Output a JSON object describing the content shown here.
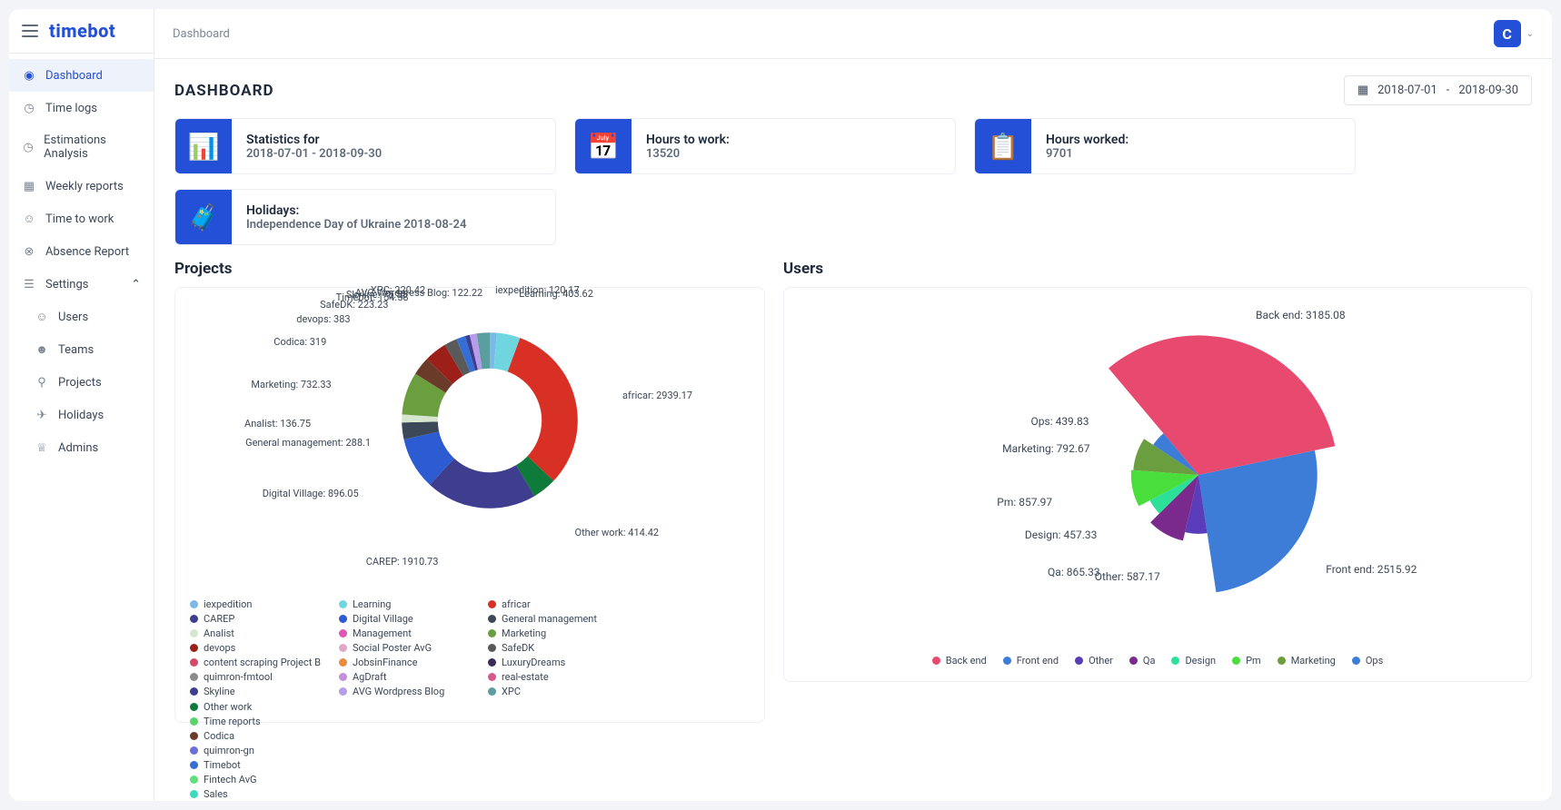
{
  "app_name": "timebot",
  "breadcrumb": "Dashboard",
  "avatar_letter": "C",
  "page_title": "DASHBOARD",
  "date_range": {
    "from": "2018-07-01",
    "to": "2018-09-30"
  },
  "sidebar": {
    "items": [
      {
        "label": "Dashboard"
      },
      {
        "label": "Time logs"
      },
      {
        "label": "Estimations Analysis"
      },
      {
        "label": "Weekly reports"
      },
      {
        "label": "Time to work"
      },
      {
        "label": "Absence Report"
      },
      {
        "label": "Settings"
      }
    ],
    "settings_children": [
      {
        "label": "Users"
      },
      {
        "label": "Teams"
      },
      {
        "label": "Projects"
      },
      {
        "label": "Holidays"
      },
      {
        "label": "Admins"
      }
    ]
  },
  "stats": [
    {
      "label": "Statistics for",
      "value": "2018-07-01 - 2018-09-30"
    },
    {
      "label": "Hours to work:",
      "value": "13520"
    },
    {
      "label": "Hours worked:",
      "value": "9701"
    },
    {
      "label": "Holidays:",
      "value": "Independence Day of Ukraine 2018-08-24"
    }
  ],
  "sections": {
    "projects": "Projects",
    "users": "Users"
  },
  "chart_data": [
    {
      "type": "pie",
      "title": "Projects",
      "donut": true,
      "series": [
        {
          "name": "iexpedition",
          "value": 120.17,
          "color": "#7bb9e8"
        },
        {
          "name": "Learning",
          "value": 403.62,
          "color": "#6fd6e0"
        },
        {
          "name": "africar",
          "value": 2939.17,
          "color": "#d93025"
        },
        {
          "name": "Other work",
          "value": 414.42,
          "color": "#0f7b3a"
        },
        {
          "name": "CAREP",
          "value": 1910.73,
          "color": "#3f3d8e"
        },
        {
          "name": "Digital Village",
          "value": 896.05,
          "color": "#2d5bd1"
        },
        {
          "name": "General management",
          "value": 288.1,
          "color": "#3c4858"
        },
        {
          "name": "Time reports",
          "value": null,
          "color": "#5ad46a"
        },
        {
          "name": "Analist",
          "value": 136.75,
          "color": "#d7e7cf"
        },
        {
          "name": "Management",
          "value": null,
          "color": "#e255b1"
        },
        {
          "name": "Marketing",
          "value": 732.33,
          "color": "#6b9e3f"
        },
        {
          "name": "Codica",
          "value": 319,
          "color": "#6b3b2a"
        },
        {
          "name": "devops",
          "value": 383,
          "color": "#9c1f1a"
        },
        {
          "name": "Social Poster AvG",
          "value": null,
          "color": "#e0a8c8"
        },
        {
          "name": "SafeDK",
          "value": 223.23,
          "color": "#5a5a5a"
        },
        {
          "name": "quimron-gn",
          "value": null,
          "color": "#6c6ed9"
        },
        {
          "name": "content scraping Project B",
          "value": null,
          "color": "#d54a6a"
        },
        {
          "name": "JobsinFinance",
          "value": null,
          "color": "#e88b3d"
        },
        {
          "name": "LuxuryDreams",
          "value": null,
          "color": "#3a2a5c"
        },
        {
          "name": "Timebot",
          "value": 154.58,
          "color": "#356fd6"
        },
        {
          "name": "quimron-fmtool",
          "value": null,
          "color": "#8c8c8c"
        },
        {
          "name": "AgDraft",
          "value": null,
          "color": "#c58fd9"
        },
        {
          "name": "real-estate",
          "value": null,
          "color": "#d65a8f"
        },
        {
          "name": "Fintech AvG",
          "value": null,
          "color": "#5fe07a"
        },
        {
          "name": "Skyline",
          "value": 78.55,
          "color": "#3f3d8e"
        },
        {
          "name": "AVG Wordpress Blog",
          "value": 122.22,
          "color": "#b89ce8"
        },
        {
          "name": "XPC",
          "value": 220.42,
          "color": "#5a9ea0"
        },
        {
          "name": "Sales",
          "value": null,
          "color": "#3dd9c0"
        }
      ]
    },
    {
      "type": "pie",
      "title": "Users",
      "series": [
        {
          "name": "Back end",
          "value": 3185.08,
          "color": "#e84a6f"
        },
        {
          "name": "Front end",
          "value": 2515.92,
          "color": "#3d7dd8"
        },
        {
          "name": "Other",
          "value": 587.17,
          "color": "#5a3dba"
        },
        {
          "name": "Qa",
          "value": 865.33,
          "color": "#7a2a8c"
        },
        {
          "name": "Design",
          "value": 457.33,
          "color": "#2de09a"
        },
        {
          "name": "Pm",
          "value": 857.97,
          "color": "#4ade3d"
        },
        {
          "name": "Marketing",
          "value": 792.67,
          "color": "#6b9e3f"
        },
        {
          "name": "Ops",
          "value": 439.83,
          "color": "#3d7dd8"
        }
      ]
    }
  ]
}
